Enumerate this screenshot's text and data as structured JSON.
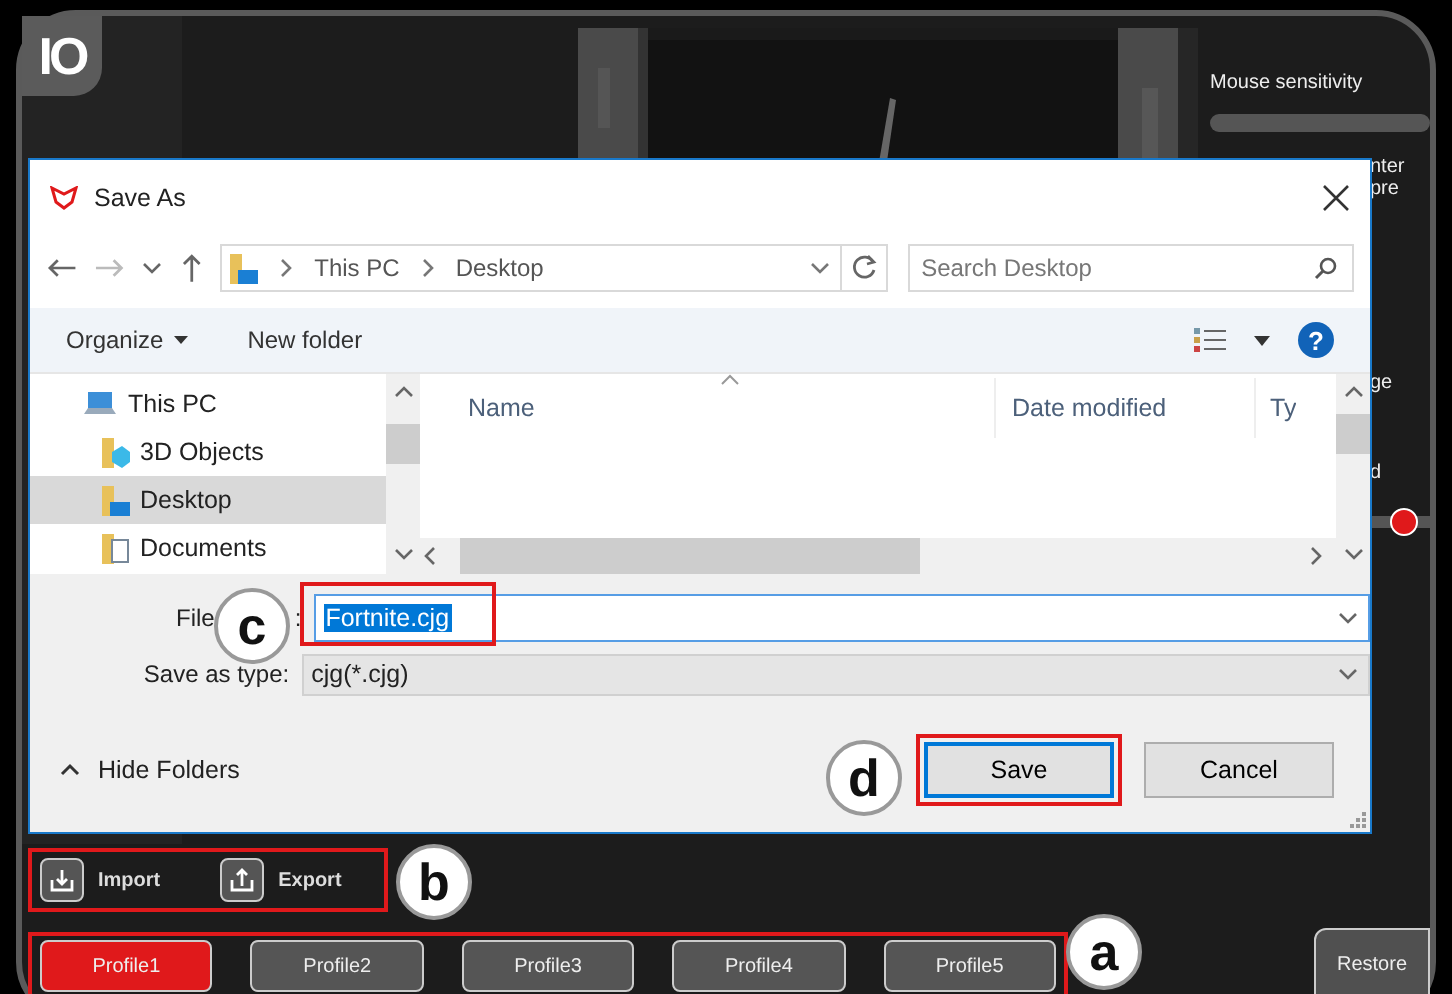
{
  "app": {
    "logo": "IO",
    "right_panel": {
      "title": "Mouse sensitivity",
      "labels": [
        "nter pre",
        "ge",
        "d"
      ]
    },
    "io_buttons": [
      {
        "kind": "import",
        "label": "Import"
      },
      {
        "kind": "export",
        "label": "Export"
      }
    ],
    "profiles": [
      {
        "label": "Profile1",
        "selected": true
      },
      {
        "label": "Profile2",
        "selected": false
      },
      {
        "label": "Profile3",
        "selected": false
      },
      {
        "label": "Profile4",
        "selected": false
      },
      {
        "label": "Profile5",
        "selected": false
      }
    ],
    "restore": "Restore"
  },
  "dialog": {
    "title": "Save As",
    "breadcrumb": [
      "This PC",
      "Desktop"
    ],
    "search": {
      "placeholder": "Search Desktop"
    },
    "toolbar": {
      "organize": "Organize",
      "new_folder": "New folder",
      "help": "?"
    },
    "tree": [
      {
        "kind": "pc",
        "label": "This PC",
        "selected": false
      },
      {
        "kind": "objects",
        "label": "3D Objects",
        "selected": false
      },
      {
        "kind": "desktop",
        "label": "Desktop",
        "selected": true
      },
      {
        "kind": "documents",
        "label": "Documents",
        "selected": false
      }
    ],
    "columns": [
      "Name",
      "Date modified",
      "Ty"
    ],
    "file_name": {
      "label_start": "File",
      "label_end": ":",
      "value": "Fortnite.cjg"
    },
    "save_type": {
      "label": "Save as type:",
      "value": "cjg(*.cjg)"
    },
    "hide_folders": "Hide Folders",
    "buttons": [
      {
        "kind": "primary",
        "label": "Save"
      },
      {
        "kind": "secondary",
        "label": "Cancel"
      }
    ]
  },
  "markers": [
    {
      "kind": "profiles",
      "letter": "a"
    },
    {
      "kind": "io",
      "letter": "b"
    },
    {
      "kind": "file_name",
      "letter": "c"
    },
    {
      "kind": "save",
      "letter": "d"
    }
  ]
}
